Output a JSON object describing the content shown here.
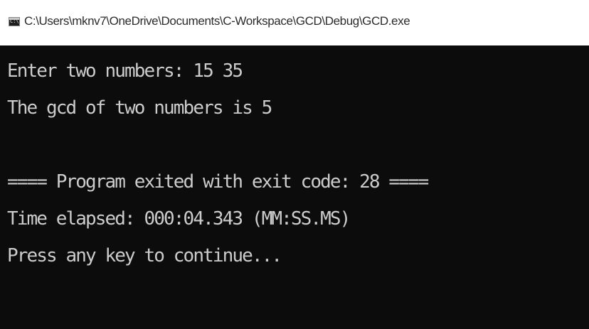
{
  "window": {
    "title": "C:\\Users\\mknv7\\OneDrive\\Documents\\C-Workspace\\GCD\\Debug\\GCD.exe",
    "icon": "console-app-icon",
    "icon_glyph": "C:\\"
  },
  "console": {
    "lines": [
      "Enter two numbers: 15 35",
      "The gcd of two numbers is 5",
      "",
      "==== Program exited with exit code: 28 ====",
      "Time elapsed: 000:04.343 (MM:SS.MS)",
      "Press any key to continue..."
    ]
  },
  "colors": {
    "console_background": "#0c0c0c",
    "console_text": "#cccccc",
    "titlebar_background": "#ffffff"
  }
}
